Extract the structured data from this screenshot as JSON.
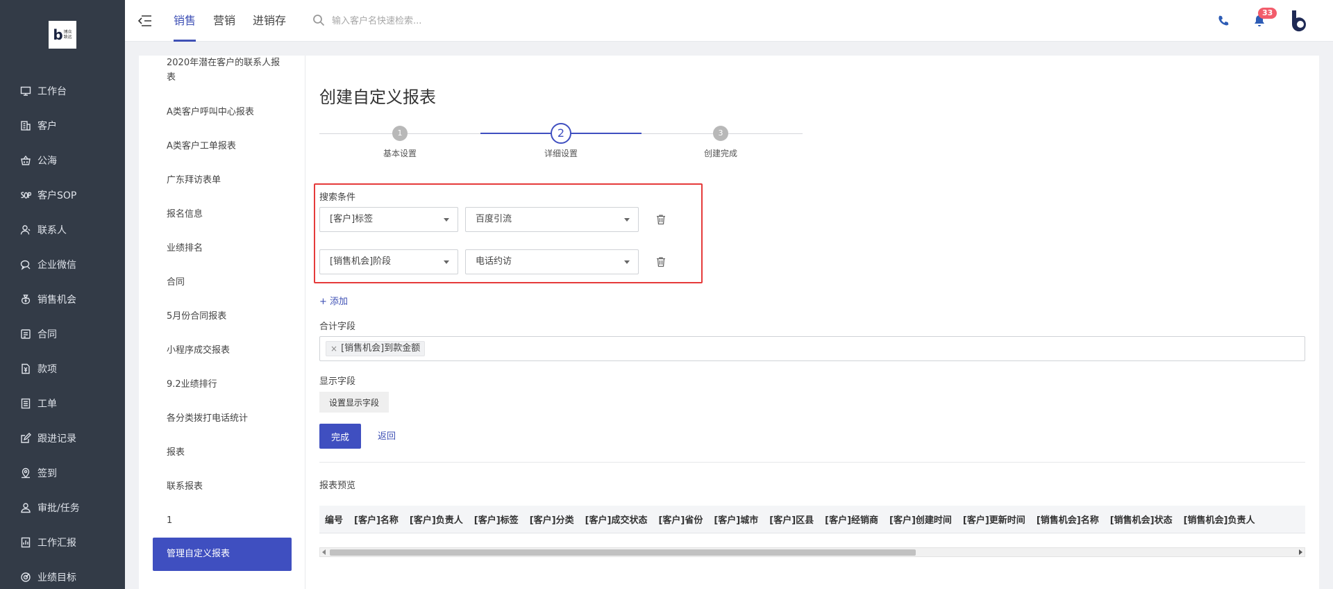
{
  "logo": {
    "mark": "b",
    "text_line1": "博众",
    "text_line2": "致远"
  },
  "sidebar": {
    "items": [
      {
        "label": "工作台",
        "icon": "desktop-icon"
      },
      {
        "label": "客户",
        "icon": "building-icon"
      },
      {
        "label": "公海",
        "icon": "basket-icon"
      },
      {
        "label": "客户SOP",
        "icon": "sop-icon"
      },
      {
        "label": "联系人",
        "icon": "person-icon"
      },
      {
        "label": "企业微信",
        "icon": "chat-icon"
      },
      {
        "label": "销售机会",
        "icon": "money-bag-icon"
      },
      {
        "label": "合同",
        "icon": "contract-icon"
      },
      {
        "label": "款项",
        "icon": "payment-icon"
      },
      {
        "label": "工单",
        "icon": "ticket-icon"
      },
      {
        "label": "跟进记录",
        "icon": "edit-icon"
      },
      {
        "label": "签到",
        "icon": "location-icon"
      },
      {
        "label": "审批/任务",
        "icon": "approval-icon"
      },
      {
        "label": "工作汇报",
        "icon": "report-icon"
      },
      {
        "label": "业绩目标",
        "icon": "target-icon"
      }
    ]
  },
  "topbar": {
    "tabs": [
      {
        "label": "销售",
        "active": true
      },
      {
        "label": "营销",
        "active": false
      },
      {
        "label": "进销存",
        "active": false
      }
    ],
    "search_placeholder": "输入客户名快速检索...",
    "notification_count": "33",
    "accent_color": "#3f4fc0"
  },
  "report_list": {
    "items": [
      "2020年潜在客户的联系人报表",
      "A类客户呼叫中心报表",
      "A类客户工单报表",
      "广东拜访表单",
      "报名信息",
      "业绩排名",
      "合同",
      "5月份合同报表",
      "小程序成交报表",
      "9.2业绩排行",
      "各分类拨打电话统计",
      "报表",
      "联系报表",
      "1"
    ],
    "active_item": "管理自定义报表"
  },
  "main": {
    "title": "创建自定义报表",
    "steps": [
      {
        "number": "1",
        "label": "基本设置"
      },
      {
        "number": "2",
        "label": "详细设置"
      },
      {
        "number": "3",
        "label": "创建完成"
      }
    ],
    "search_conditions_label": "搜索条件",
    "conditions": [
      {
        "field": "[客户]标签",
        "value": "百度引流"
      },
      {
        "field": "[销售机会]阶段",
        "value": "电话约访"
      }
    ],
    "add_label": "+ 添加",
    "sum_field_label": "合计字段",
    "sum_tags": [
      "[销售机会]到款金额"
    ],
    "display_field_label": "显示字段",
    "set_display_button": "设置显示字段",
    "finish_button": "完成",
    "back_link": "返回",
    "preview_label": "报表预览",
    "preview_columns": [
      "编号",
      "[客户]名称",
      "[客户]负责人",
      "[客户]标签",
      "[客户]分类",
      "[客户]成交状态",
      "[客户]省份",
      "[客户]城市",
      "[客户]区县",
      "[客户]经销商",
      "[客户]创建时间",
      "[客户]更新时间",
      "[销售机会]名称",
      "[销售机会]状态",
      "[销售机会]负责人"
    ]
  }
}
